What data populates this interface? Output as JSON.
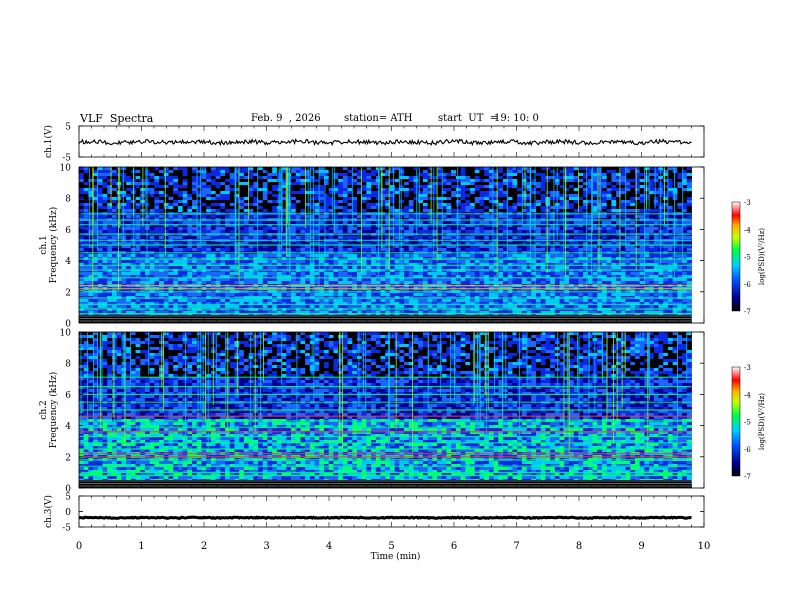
{
  "header": {
    "title": "VLF  Spectra",
    "date": "Feb. 9  , 2026",
    "station": "station= ATH",
    "start_label": "start  UT  =",
    "start_time": "19: 10: 0"
  },
  "chart_data": [
    {
      "type": "line",
      "panel": "ch1-waveform",
      "ylabel": "ch.1(V)",
      "ylim": [
        -5,
        5
      ],
      "yticks": [
        "5",
        "-5"
      ],
      "x_range_min": [
        0,
        9.8
      ],
      "series": [
        {
          "color": "#000000",
          "baseline": -0.2,
          "noise_amplitude": 0.7
        }
      ]
    },
    {
      "type": "heatmap",
      "panel": "ch1-spectrogram",
      "ylabel": "ch.1\nFrequency  (kHz)",
      "ylim": [
        0,
        10
      ],
      "yticks": [
        "0",
        "2",
        "4",
        "6",
        "8",
        "10"
      ],
      "x_range_min": [
        0,
        9.8
      ],
      "bands_khz": [
        0.3,
        0.6,
        0.9,
        1.2,
        1.6,
        2.0,
        2.2,
        2.4,
        2.9,
        3.4,
        3.7,
        4.1,
        4.5,
        5.0,
        5.3,
        5.7,
        6.3,
        6.6,
        7.0
      ],
      "colorbar": {
        "label": "log(PSD)(V²/Hz)",
        "range": [
          -7,
          -3
        ],
        "ticks": [
          "-3",
          "-4",
          "-5",
          "-6",
          "-7"
        ]
      }
    },
    {
      "type": "heatmap",
      "panel": "ch2-spectrogram",
      "ylabel": "ch.2\nFrequency  (kHz)",
      "ylim": [
        0,
        10
      ],
      "yticks": [
        "0",
        "2",
        "4",
        "6",
        "8",
        "10"
      ],
      "x_range_min": [
        0,
        9.8
      ],
      "bands_khz": [
        0.4,
        0.8,
        1.0,
        1.4,
        1.8,
        2.0,
        2.2,
        2.5,
        2.9,
        3.3,
        3.6,
        3.9,
        4.3,
        4.6,
        5.0,
        5.5,
        6.0,
        6.5,
        7.1
      ],
      "colorbar": {
        "label": "log(PSD)(V²/Hz)",
        "range": [
          -7,
          -3
        ],
        "ticks": [
          "-3",
          "-4",
          "-5",
          "-6",
          "-7"
        ]
      }
    },
    {
      "type": "line",
      "panel": "ch3-waveform",
      "ylabel": "ch.3(V)",
      "ylim": [
        -5,
        5
      ],
      "yticks": [
        "5",
        "0",
        "-5"
      ],
      "x_range_min": [
        0,
        9.8
      ],
      "series": [
        {
          "color": "#000000",
          "baseline": -2.0,
          "noise_amplitude": 0.15
        }
      ]
    }
  ],
  "xaxis": {
    "label": "Time  (min)",
    "range": [
      0,
      10
    ],
    "ticks": [
      "0",
      "1",
      "2",
      "3",
      "4",
      "5",
      "6",
      "7",
      "8",
      "9",
      "10"
    ]
  }
}
